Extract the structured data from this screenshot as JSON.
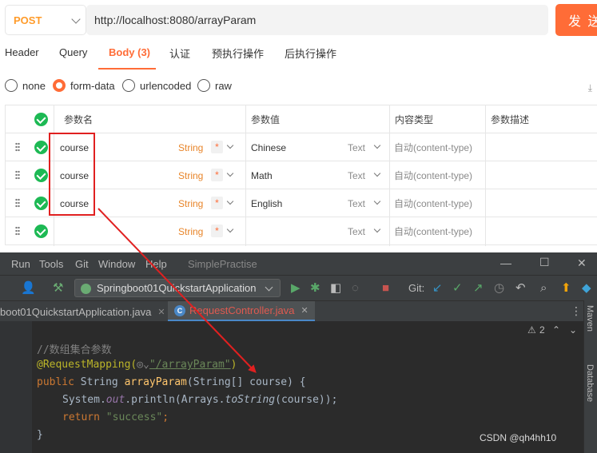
{
  "request": {
    "method": "POST",
    "url": "http://localhost:8080/arrayParam",
    "send_label": "发 送"
  },
  "tabs": [
    {
      "label": "Header"
    },
    {
      "label": "Query"
    },
    {
      "label": "Body (3)"
    },
    {
      "label": "认证"
    },
    {
      "label": "预执行操作"
    },
    {
      "label": "后执行操作"
    }
  ],
  "body_types": [
    {
      "label": "none",
      "selected": false
    },
    {
      "label": "form-data",
      "selected": true
    },
    {
      "label": "urlencoded",
      "selected": false
    },
    {
      "label": "raw",
      "selected": false
    }
  ],
  "table": {
    "headers": {
      "name": "参数名",
      "value": "参数值",
      "content_type": "内容类型",
      "desc": "参数描述"
    },
    "rows": [
      {
        "name": "course",
        "type": "String",
        "required": "*",
        "value": "Chinese",
        "vtype": "Text",
        "content_type": "自动(content-type)"
      },
      {
        "name": "course",
        "type": "String",
        "required": "*",
        "value": "Math",
        "vtype": "Text",
        "content_type": "自动(content-type)"
      },
      {
        "name": "course",
        "type": "String",
        "required": "*",
        "value": "English",
        "vtype": "Text",
        "content_type": "自动(content-type)"
      },
      {
        "name": "",
        "type": "String",
        "required": "*",
        "value": "",
        "vtype": "Text",
        "content_type": "自动(content-type)"
      }
    ]
  },
  "ide": {
    "menu": [
      "Run",
      "Tools",
      "Git",
      "Window",
      "Help"
    ],
    "project": "SimplePractise",
    "run_config": "Springboot01QuickstartApplication",
    "git_label": "Git:",
    "file_tabs": [
      {
        "label": "boot01QuickstartApplication.java"
      },
      {
        "label": "RequestController.java"
      }
    ],
    "warning_count": "2",
    "side_tabs": [
      "Maven",
      "Database"
    ],
    "code": {
      "comment": "//数组集合参数",
      "annotation": "@RequestMapping(",
      "path": "\"/arrayParam\"",
      "annotation_end": ")",
      "public_kw": "public",
      "sig_type": " String ",
      "method": "arrayParam",
      "params": "(String[] course) {",
      "print_a": "System.",
      "out": "out",
      "print_b": ".println(Arrays.",
      "tostring": "toString",
      "print_c": "(course));",
      "return_kw": "return",
      "return_val": "\"success\"",
      "semicolon": ";",
      "close": "}"
    }
  },
  "watermark": "CSDN @qh4hh10"
}
